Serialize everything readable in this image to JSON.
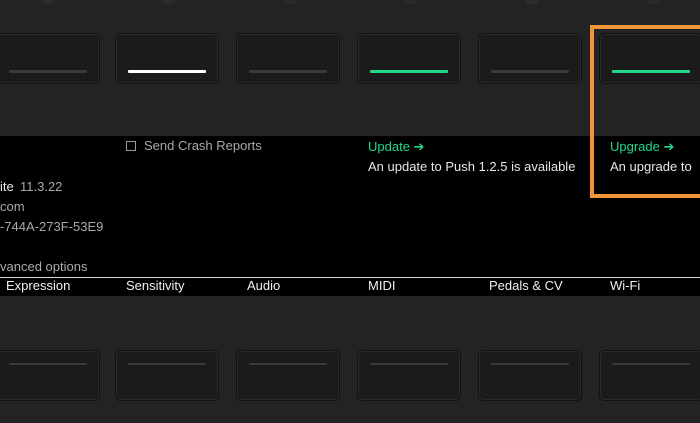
{
  "settings": {
    "send_crash_reports_label": "Send Crash Reports",
    "live_version_label": "ite",
    "live_version_value": "11.3.22",
    "email_fragment": "com",
    "serial_fragment": "-744A-273F-53E9",
    "advanced_options_label": "vanced options",
    "update": {
      "link_label": "Update",
      "arrow": "➔",
      "message": "An update to Push 1.2.5 is available"
    },
    "upgrade": {
      "link_label": "Upgrade",
      "arrow": "➔",
      "message": "An upgrade to"
    }
  },
  "tabs": [
    "Expression",
    "Sensitivity",
    "Audio",
    "MIDI",
    "Pedals & CV",
    "Wi-Fi"
  ],
  "colors": {
    "accent_green": "#22d98a",
    "highlight_orange": "#f0963a",
    "screen_bg": "#000000",
    "hardware_bg": "#232323"
  }
}
